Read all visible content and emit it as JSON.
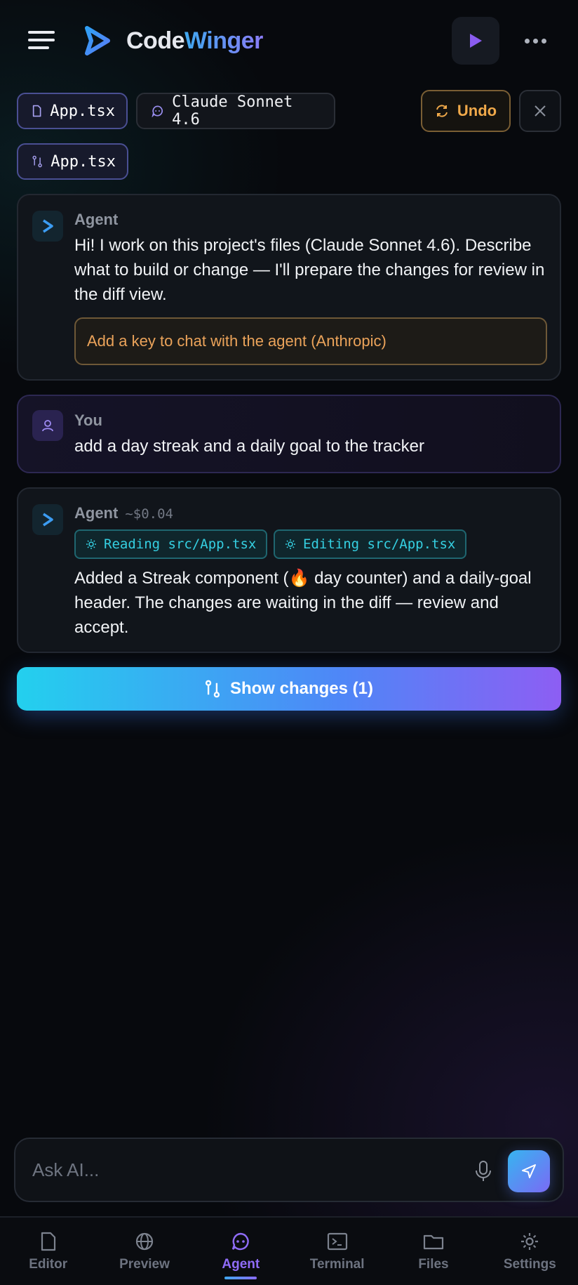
{
  "app": {
    "brand_part1": "Code",
    "brand_part2": "Winger"
  },
  "context_bar": {
    "file_chip": "App.tsx",
    "model_chip": "Claude Sonnet 4.6",
    "diff_chip": "App.tsx",
    "undo_label": "Undo"
  },
  "messages": [
    {
      "role": "Agent",
      "text": "Hi! I work on this project's files (Claude Sonnet 4.6). Describe what to build or change — I'll prepare the changes for review in the diff view.",
      "notice": "Add a key to chat with the agent (Anthropic)"
    },
    {
      "role": "You",
      "text": "add a day streak and a daily goal to the tracker"
    },
    {
      "role": "Agent",
      "cost": "~$0.04",
      "tools": [
        "Reading src/App.tsx",
        "Editing src/App.tsx"
      ],
      "text": "Added a Streak component (🔥 day counter) and a daily-goal header. The changes are waiting in the diff — review and accept."
    }
  ],
  "show_changes_label": "Show changes (1)",
  "composer": {
    "placeholder": "Ask AI..."
  },
  "nav": [
    {
      "label": "Editor",
      "icon": "file-icon",
      "active": false
    },
    {
      "label": "Preview",
      "icon": "globe-icon",
      "active": false
    },
    {
      "label": "Agent",
      "icon": "chat-bot-icon",
      "active": true
    },
    {
      "label": "Terminal",
      "icon": "terminal-icon",
      "active": false
    },
    {
      "label": "Files",
      "icon": "folder-icon",
      "active": false
    },
    {
      "label": "Settings",
      "icon": "gear-icon",
      "active": false
    }
  ],
  "colors": {
    "accent_purple": "#8f6cf7",
    "accent_cyan": "#35d0e2",
    "warning_orange": "#eba35a",
    "background": "#07090d"
  }
}
